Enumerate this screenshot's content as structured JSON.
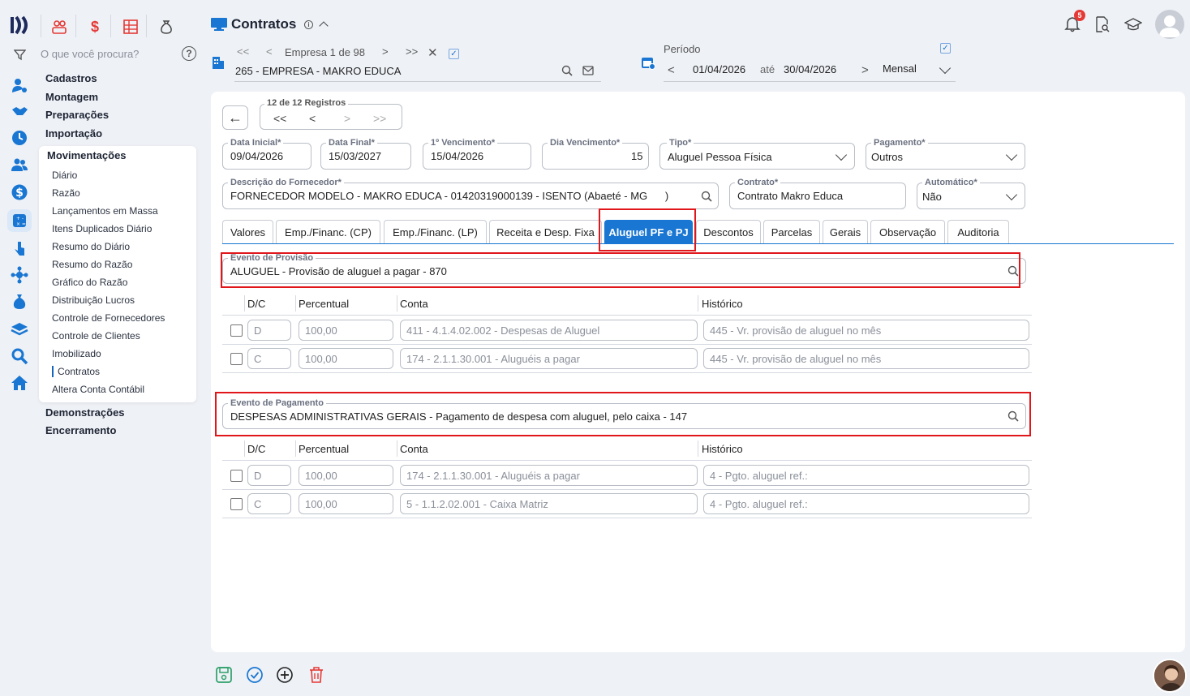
{
  "search": {
    "placeholder": "O que você procura?",
    "help": "?"
  },
  "menu": {
    "top": [
      "Cadastros",
      "Montagem",
      "Preparações",
      "Importação"
    ],
    "movimentacoes": {
      "title": "Movimentações",
      "items": [
        "Diário",
        "Razão",
        "Lançamentos em Massa",
        "Itens Duplicados Diário",
        "Resumo do Diário",
        "Resumo do Razão",
        "Gráfico do Razão",
        "Distribuição Lucros",
        "Controle de Fornecedores",
        "Controle de Clientes",
        "Imobilizado",
        "Contratos",
        "Altera Conta Contábil"
      ]
    },
    "bottom": [
      "Demonstrações",
      "Encerramento"
    ]
  },
  "header": {
    "title": "Contratos",
    "empresa_nav": "Empresa 1 de 98",
    "empresa": "265 - EMPRESA - MAKRO EDUCA",
    "periodo_label": "Período",
    "data_ini": "01/04/2026",
    "ate": "até",
    "data_fim": "30/04/2026",
    "periodicidade": "Mensal",
    "notif_count": "5"
  },
  "registros": {
    "label": "12 de 12 Registros"
  },
  "form": {
    "data_inicial": {
      "label": "Data Inicial*",
      "value": "09/04/2026"
    },
    "data_final": {
      "label": "Data Final*",
      "value": "15/03/2027"
    },
    "vencimento": {
      "label": "1º Vencimento*",
      "value": "15/04/2026"
    },
    "dia_venc": {
      "label": "Dia Vencimento*",
      "value": "15"
    },
    "tipo": {
      "label": "Tipo*",
      "value": "Aluguel Pessoa Física"
    },
    "pagamento": {
      "label": "Pagamento*",
      "value": "Outros"
    },
    "fornecedor": {
      "label": "Descrição do Fornecedor*",
      "value": "FORNECEDOR MODELO - MAKRO EDUCA - 01420319000139 - ISENTO (Abaeté - MG      )"
    },
    "contrato": {
      "label": "Contrato*",
      "value": "Contrato Makro Educa"
    },
    "automatico": {
      "label": "Automático*",
      "value": "Não"
    }
  },
  "tabs": [
    "Valores",
    "Emp./Financ. (CP)",
    "Emp./Financ. (LP)",
    "Receita e Desp. Fixa",
    "Aluguel PF e PJ",
    "Descontos",
    "Parcelas",
    "Gerais",
    "Observação",
    "Auditoria"
  ],
  "provisao": {
    "label": "Evento de Provisão",
    "value": "ALUGUEL - Provisão de aluguel a pagar - 870",
    "headers": [
      "D/C",
      "Percentual",
      "Conta",
      "Histórico"
    ],
    "rows": [
      {
        "dc": "D",
        "perc": "100,00",
        "conta": "411 - 4.1.4.02.002 - Despesas de Aluguel",
        "hist": "445 - Vr. provisão de aluguel no mês"
      },
      {
        "dc": "C",
        "perc": "100,00",
        "conta": "174 - 2.1.1.30.001 - Aluguéis a pagar",
        "hist": "445 - Vr. provisão de aluguel no mês"
      }
    ]
  },
  "pagamento_ev": {
    "label": "Evento de Pagamento",
    "value": "DESPESAS ADMINISTRATIVAS GERAIS - Pagamento de despesa com aluguel, pelo caixa - 147",
    "headers": [
      "D/C",
      "Percentual",
      "Conta",
      "Histórico"
    ],
    "rows": [
      {
        "dc": "D",
        "perc": "100,00",
        "conta": "174 - 2.1.1.30.001 - Aluguéis a pagar",
        "hist": "4 - Pgto. aluguel ref.:"
      },
      {
        "dc": "C",
        "perc": "100,00",
        "conta": "5 - 1.1.2.02.001 - Caixa Matriz",
        "hist": "4 - Pgto. aluguel ref.:"
      }
    ]
  },
  "colors": {
    "accent": "#1976d2",
    "highlight": "#e0161b",
    "danger": "#e53935"
  }
}
